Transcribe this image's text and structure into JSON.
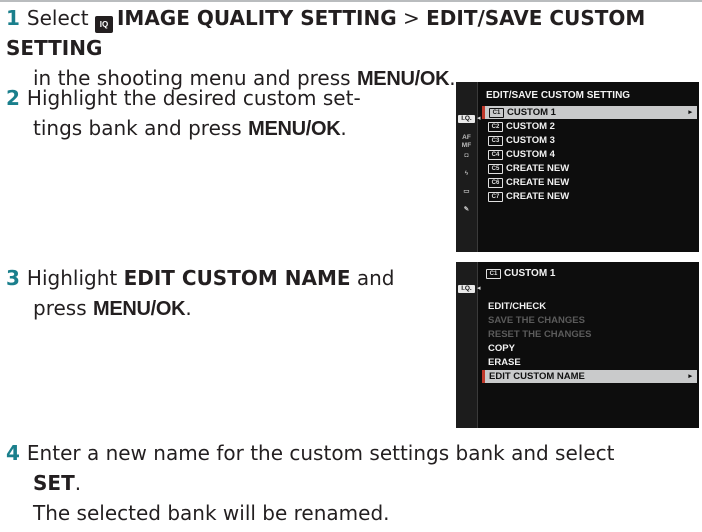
{
  "step1": {
    "num": "1",
    "pre": "Select ",
    "badge": "IQ",
    "menu": "IMAGE QUALITY SETTING",
    "sep": " > ",
    "sub": "EDIT/SAVE CUSTOM SETTING",
    "mid": " in the shooting menu and press ",
    "key": "MENU/OK",
    "end": "."
  },
  "step2": {
    "num": "2",
    "line1": "Highlight the desired custom set-",
    "line2_pre": "tings bank and press ",
    "key": "MENU/OK",
    "end": "."
  },
  "step3": {
    "num": "3",
    "pre": "Highlight ",
    "target": "EDIT CUSTOM NAME",
    "mid": " and",
    "line2_pre": "press ",
    "key": "MENU/OK",
    "end": "."
  },
  "step4": {
    "num": "4",
    "line1": "Enter a new name for the custom settings bank and select",
    "set": "SET",
    "end": ".",
    "result": "The selected bank will be renamed."
  },
  "screen1": {
    "title": "EDIT/SAVE CUSTOM SETTING",
    "items": [
      {
        "badge": "C1",
        "label": "CUSTOM 1"
      },
      {
        "badge": "C2",
        "label": "CUSTOM 2"
      },
      {
        "badge": "C3",
        "label": "CUSTOM 3"
      },
      {
        "badge": "C4",
        "label": "CUSTOM 4"
      },
      {
        "badge": "C5",
        "label": "CREATE NEW"
      },
      {
        "badge": "C6",
        "label": "CREATE NEW"
      },
      {
        "badge": "C7",
        "label": "CREATE NEW"
      }
    ],
    "caret": "▸",
    "tabs": [
      "I.Q.",
      "AF MF",
      "",
      "",
      "",
      ""
    ]
  },
  "screen2": {
    "title_badge": "C1",
    "title": "CUSTOM 1",
    "items": [
      {
        "label": "EDIT/CHECK",
        "state": "normal"
      },
      {
        "label": "SAVE THE CHANGES",
        "state": "dim"
      },
      {
        "label": "RESET THE CHANGES",
        "state": "dim"
      },
      {
        "label": "COPY",
        "state": "normal"
      },
      {
        "label": "ERASE",
        "state": "normal"
      },
      {
        "label": "EDIT CUSTOM NAME",
        "state": "selected"
      }
    ],
    "caret": "▸"
  }
}
